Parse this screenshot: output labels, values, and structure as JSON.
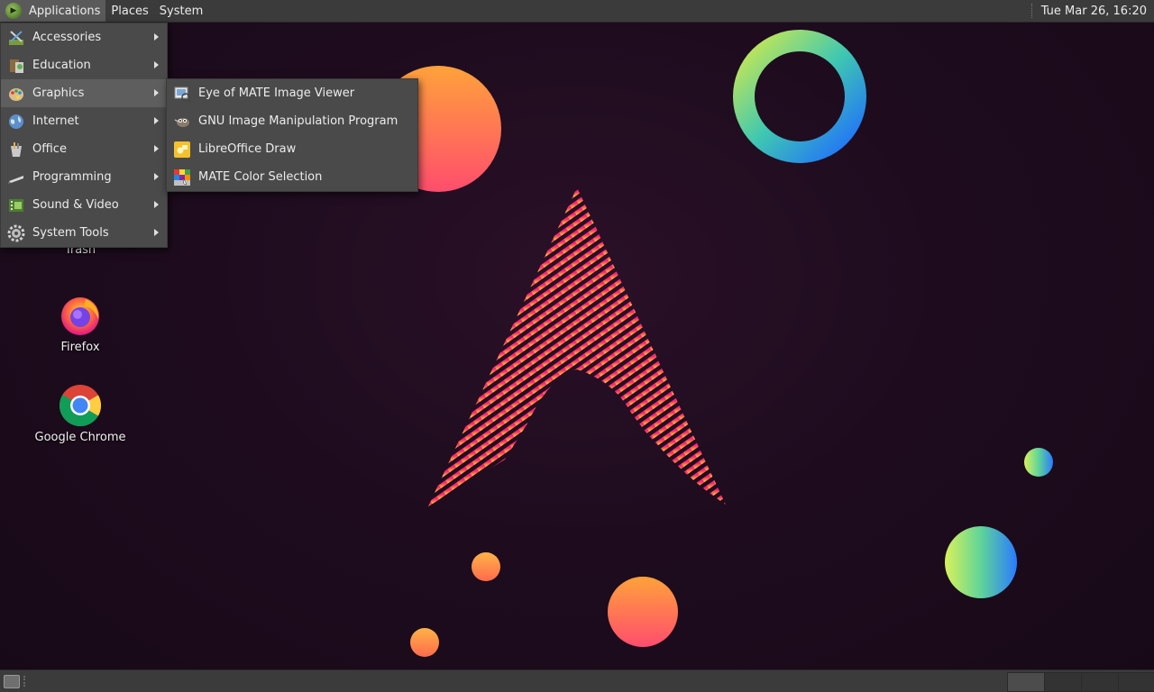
{
  "top_panel": {
    "menus": [
      "Applications",
      "Places",
      "System"
    ],
    "clock": "Tue Mar 26, 16:20"
  },
  "desktop": {
    "icons": [
      {
        "label": "Trash",
        "icon": "trash-icon"
      },
      {
        "label": "Firefox",
        "icon": "firefox-icon"
      },
      {
        "label": "Google Chrome",
        "icon": "chrome-icon"
      }
    ]
  },
  "applications_menu": {
    "items": [
      {
        "label": "Accessories",
        "icon": "accessories-icon"
      },
      {
        "label": "Education",
        "icon": "education-icon"
      },
      {
        "label": "Graphics",
        "icon": "graphics-icon"
      },
      {
        "label": "Internet",
        "icon": "internet-icon"
      },
      {
        "label": "Office",
        "icon": "office-icon"
      },
      {
        "label": "Programming",
        "icon": "programming-icon"
      },
      {
        "label": "Sound & Video",
        "icon": "sound-video-icon"
      },
      {
        "label": "System Tools",
        "icon": "system-tools-icon"
      }
    ],
    "highlighted": "Graphics"
  },
  "graphics_submenu": {
    "items": [
      {
        "label": "Eye of MATE Image Viewer",
        "icon": "image-viewer-icon"
      },
      {
        "label": "GNU Image Manipulation Program",
        "icon": "gimp-icon"
      },
      {
        "label": "LibreOffice Draw",
        "icon": "libreoffice-draw-icon"
      },
      {
        "label": "MATE Color Selection",
        "icon": "color-selection-icon"
      }
    ]
  },
  "colors": {
    "panel": "#3b3b3b",
    "menu": "#4a4a4a",
    "menu_highlight": "#5e5e5e",
    "wallpaper": "#1e0c1e",
    "accent_pink": "#ff1f7a",
    "accent_orange": "#ff9a3c"
  }
}
